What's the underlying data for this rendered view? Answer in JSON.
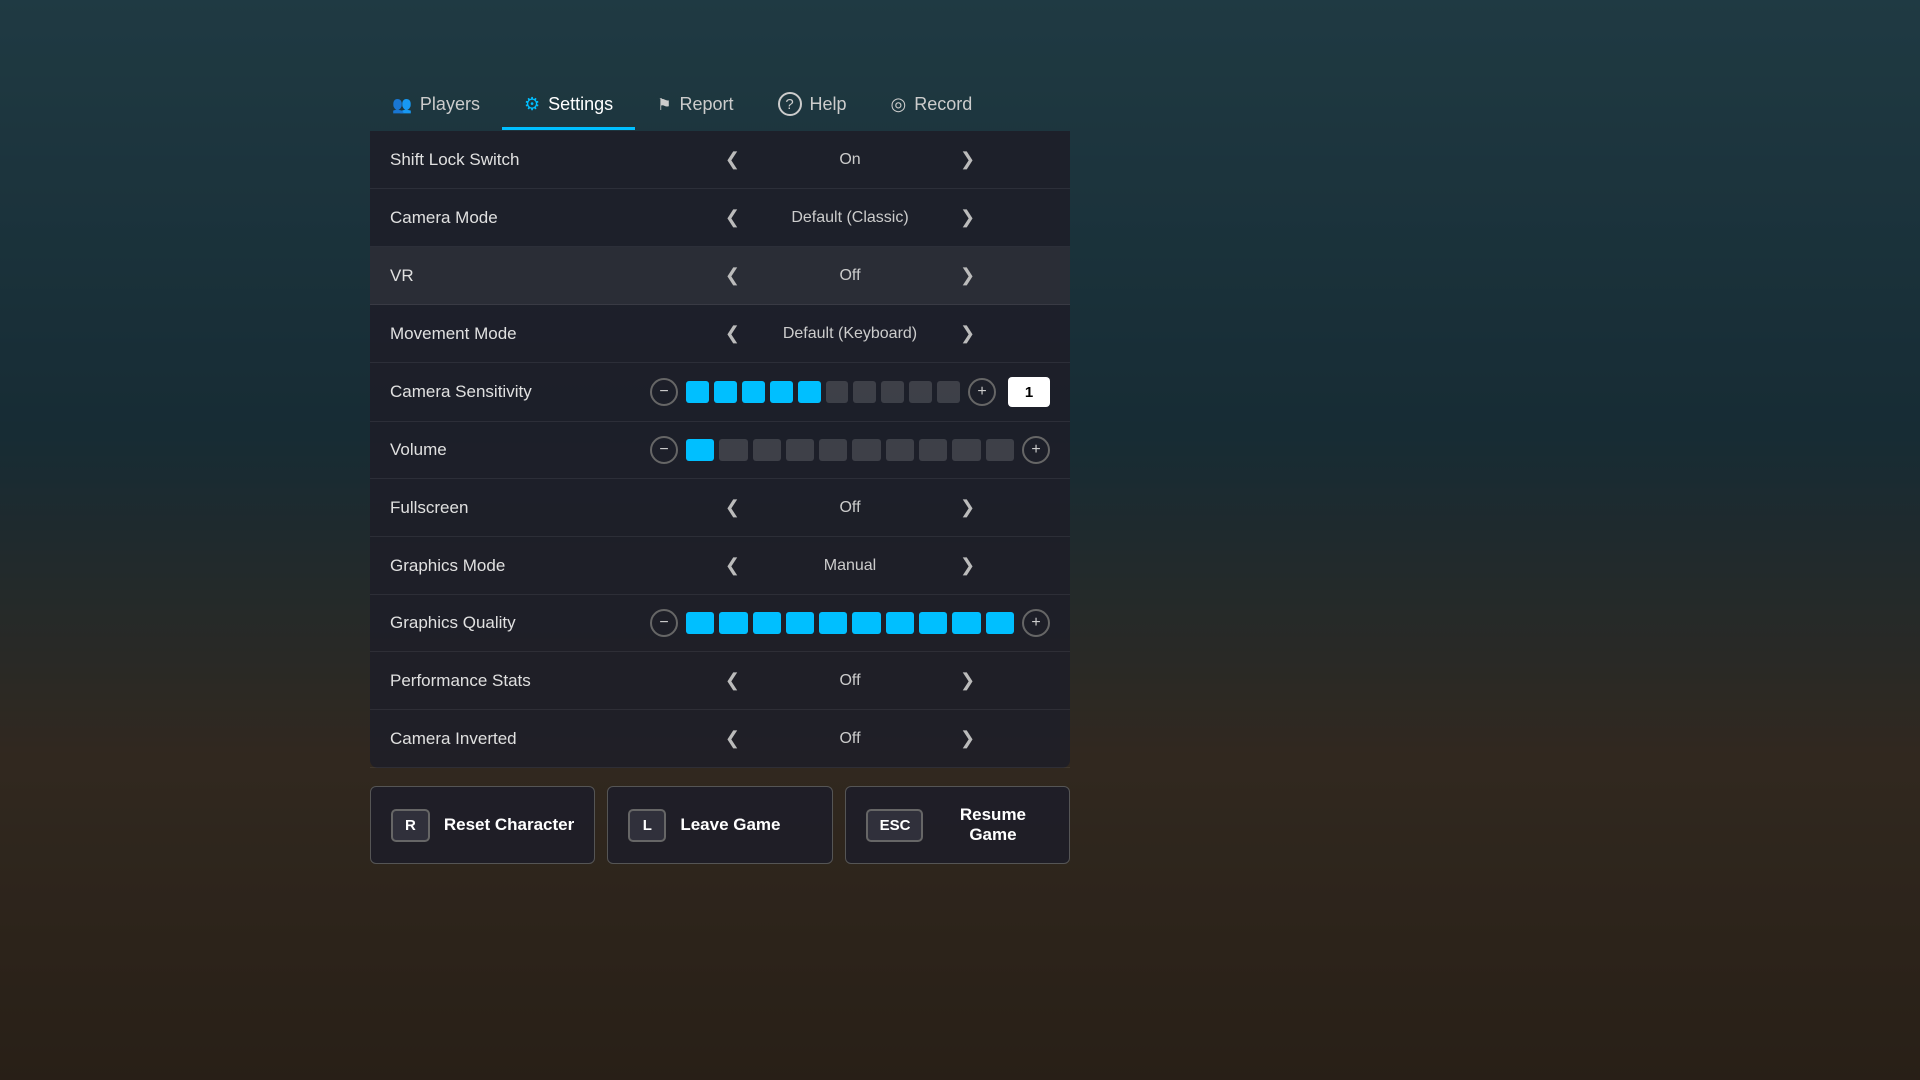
{
  "background": {
    "color": "#3a6070"
  },
  "tabs": [
    {
      "id": "players",
      "label": "Players",
      "icon": "users-icon",
      "active": false
    },
    {
      "id": "settings",
      "label": "Settings",
      "icon": "gear-icon",
      "active": true
    },
    {
      "id": "report",
      "label": "Report",
      "icon": "flag-icon",
      "active": false
    },
    {
      "id": "help",
      "label": "Help",
      "icon": "help-icon",
      "active": false
    },
    {
      "id": "record",
      "label": "Record",
      "icon": "record-icon",
      "active": false
    }
  ],
  "settings": [
    {
      "id": "shift-lock",
      "label": "Shift Lock Switch",
      "type": "toggle",
      "value": "On",
      "highlighted": false
    },
    {
      "id": "camera-mode",
      "label": "Camera Mode",
      "type": "toggle",
      "value": "Default (Classic)",
      "highlighted": false
    },
    {
      "id": "vr",
      "label": "VR",
      "type": "toggle",
      "value": "Off",
      "highlighted": true
    },
    {
      "id": "movement-mode",
      "label": "Movement Mode",
      "type": "toggle",
      "value": "Default (Keyboard)",
      "highlighted": false
    },
    {
      "id": "camera-sensitivity",
      "label": "Camera Sensitivity",
      "type": "slider",
      "filled": 5,
      "total": 10,
      "numValue": "1",
      "highlighted": false
    },
    {
      "id": "volume",
      "label": "Volume",
      "type": "slider",
      "filled": 1,
      "total": 10,
      "numValue": null,
      "highlighted": false
    },
    {
      "id": "fullscreen",
      "label": "Fullscreen",
      "type": "toggle",
      "value": "Off",
      "highlighted": false
    },
    {
      "id": "graphics-mode",
      "label": "Graphics Mode",
      "type": "toggle",
      "value": "Manual",
      "highlighted": false
    },
    {
      "id": "graphics-quality",
      "label": "Graphics Quality",
      "type": "slider",
      "filled": 10,
      "total": 10,
      "numValue": null,
      "highlighted": false
    },
    {
      "id": "performance-stats",
      "label": "Performance Stats",
      "type": "toggle",
      "value": "Off",
      "highlighted": false
    },
    {
      "id": "camera-inverted",
      "label": "Camera Inverted",
      "type": "toggle",
      "value": "Off",
      "highlighted": false
    }
  ],
  "buttons": [
    {
      "id": "reset",
      "key": "R",
      "label": "Reset Character"
    },
    {
      "id": "leave",
      "key": "L",
      "label": "Leave Game"
    },
    {
      "id": "resume",
      "key": "ESC",
      "label": "Resume Game"
    }
  ]
}
